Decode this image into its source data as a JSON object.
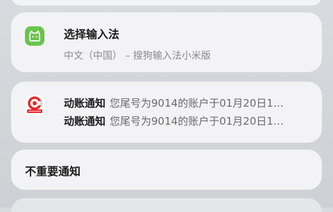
{
  "ime_notification": {
    "app_icon": "keyboard-cat-icon",
    "title": "选择输入法",
    "subtitle": "中文（中国） – 搜狗输入法小米版"
  },
  "bank_notification": {
    "app_icon": "bank-logo-icon",
    "messages": [
      {
        "title": "动账通知",
        "preview": "您尾号为9014的账户于01月20日1…"
      },
      {
        "title": "动账通知",
        "preview": "您尾号为9014的账户于01月20日1…"
      }
    ]
  },
  "minor_section": {
    "title": "不重要通知"
  }
}
